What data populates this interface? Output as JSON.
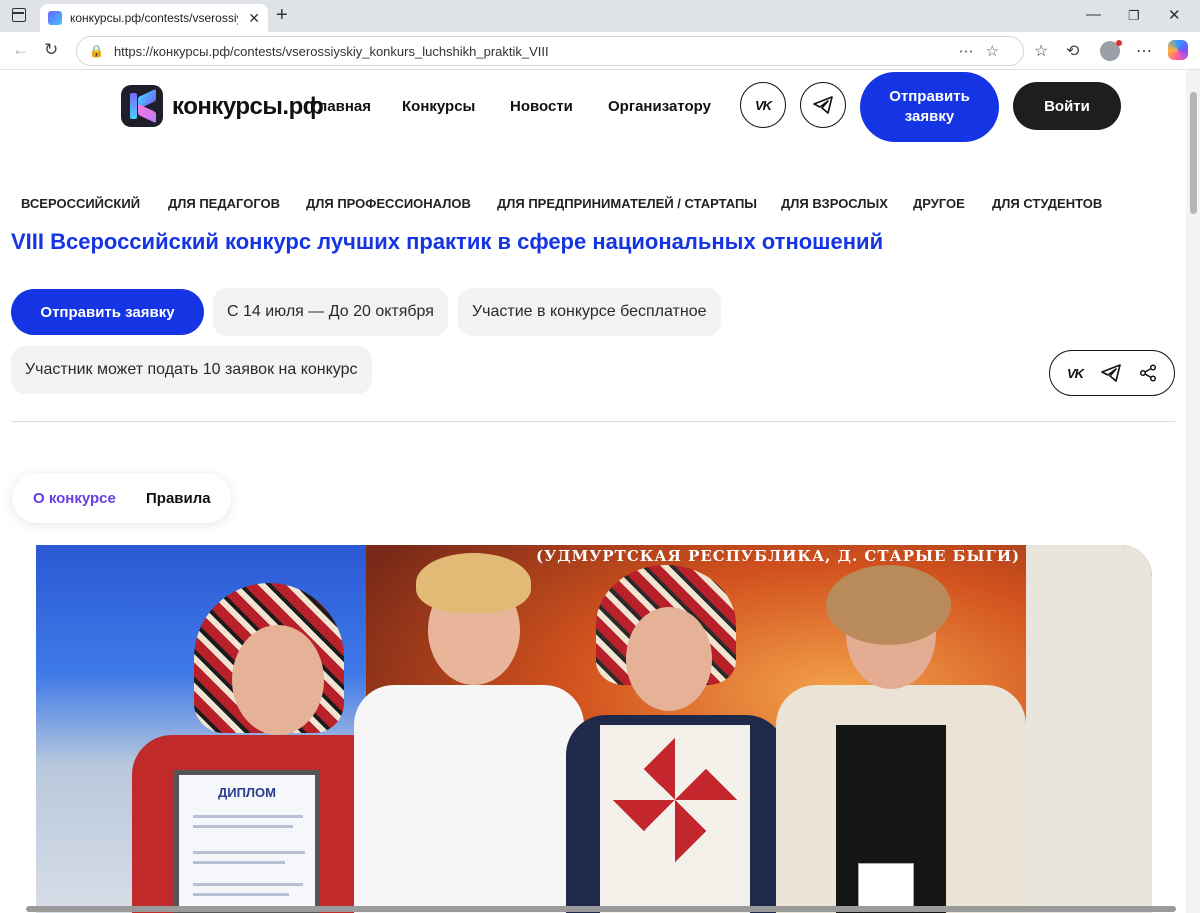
{
  "browser": {
    "tab_title": "конкурсы.рф/contests/vserossiyskiy",
    "url": "https://конкурсы.рф/contests/vserossiyskiy_konkurs_luchshikh_praktik_VIII"
  },
  "site": {
    "logo_text": "конкурсы.рф",
    "menu": [
      "Главная",
      "Конкурсы",
      "Новости",
      "Организатору"
    ],
    "submit_label": "Отправить заявку",
    "login_label": "Войти"
  },
  "categories": [
    "ВСЕРОССИЙСКИЙ",
    "ДЛЯ ПЕДАГОГОВ",
    "ДЛЯ ПРОФЕССИОНАЛОВ",
    "ДЛЯ ПРЕДПРИНИМАТЕЛЕЙ / СТАРТАПЫ",
    "ДЛЯ ВЗРОСЛЫХ",
    "ДРУГОЕ",
    "ДЛЯ СТУДЕНТОВ"
  ],
  "contest": {
    "title": "VIII Всероссийский конкурс лучших практик в сфере национальных отношений",
    "submit_label": "Отправить заявку",
    "dates": "С 14 июля — До 20 октября",
    "fee": "Участие в конкурсе бесплатное",
    "limit": "Участник может подать 10 заявок на конкурс"
  },
  "subtabs": {
    "about": "О конкурсе",
    "rules": "Правила"
  },
  "photo": {
    "banner": "(УДМУРТСКАЯ РЕСПУБЛИКА, Д. СТАРЫЕ БЫГИ)",
    "diploma_title": "ДИПЛОМ"
  },
  "colors": {
    "accent": "#1535e5",
    "active_tab": "#6a3de8",
    "dark": "#1e1e1e"
  }
}
